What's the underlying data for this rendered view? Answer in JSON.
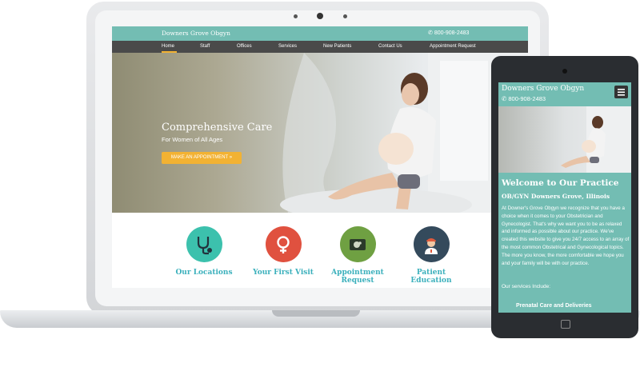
{
  "desktop": {
    "brand": "Downers Grove Obgyn",
    "phone": "800-908-2483",
    "nav": [
      "Home",
      "Staff",
      "Offices",
      "Services",
      "New Patients",
      "Contact Us",
      "Appointment Request"
    ],
    "hero": {
      "title": "Comprehensive Care",
      "subtitle": "For Women of All Ages",
      "button": "MAKE AN APPOINTMENT »"
    },
    "features": [
      {
        "label": "Our Locations",
        "icon": "stethoscope-icon",
        "color": "#3cc1ad"
      },
      {
        "label": "Your First Visit",
        "icon": "female-symbol-icon",
        "color": "#e0513f"
      },
      {
        "label": "Appointment Request",
        "icon": "ultrasound-icon",
        "color": "#6fa042"
      },
      {
        "label": "Patient Education",
        "icon": "nurse-icon",
        "color": "#344a5c"
      }
    ]
  },
  "mobile": {
    "brand": "Downers Grove Obgyn",
    "phone": "800-908-2483",
    "title": "Welcome to Our Practice",
    "subtitle": "OB/GYN Downers Grove, Illinois",
    "paragraph": "At Downer's Grove Obgyn we recognize that you have a choice when it comes to your Obstetrician and Gynecologist. That's why we want you to be as relaxed and informed as possible about our practice. We've created this website to give you 24/7 access to an array of the most common Obstetrical and Gynecological topics. The more you know, the more comfortable we hope you and your family will be with our practice.",
    "services_heading": "Our services Include:",
    "service_item": "Prenatal Care and Deliveries"
  },
  "colors": {
    "teal": "#73bdb3",
    "accent": "#f2b233",
    "nav": "#4a4a4a",
    "link": "#3bb0bc"
  }
}
